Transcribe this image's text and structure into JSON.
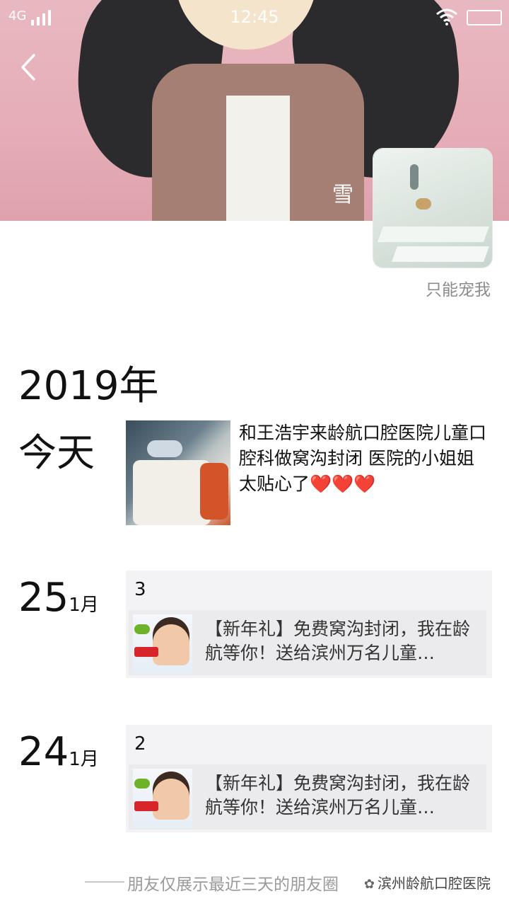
{
  "status_bar": {
    "network": "4G",
    "time": "12:45"
  },
  "profile": {
    "nickname": "雪",
    "signature": "只能宠我"
  },
  "timeline": {
    "year": "2019年",
    "today_label": "今天",
    "today_post_text": "和王浩宇来龄航口腔医院儿童口腔科做窝沟封闭 医院的小姐姐太贴心了❤️❤️❤️",
    "entries": [
      {
        "day": "25",
        "month": "1月",
        "count": "3",
        "link_title": "【新年礼】免费窝沟封闭，我在龄航等你！送给滨州万名儿童…"
      },
      {
        "day": "24",
        "month": "1月",
        "count": "2",
        "link_title": "【新年礼】免费窝沟封闭，我在龄航等你！送给滨州万名儿童…"
      }
    ]
  },
  "footer": {
    "notice": "朋友仅展示最近三天的朋友圈",
    "watermark": "滨州龄航口腔医院"
  },
  "icons": {
    "back": "back-chevron-icon",
    "wifi": "wifi-icon",
    "battery": "battery-icon",
    "signal": "signal-icon",
    "watermark": "wechat-icon"
  }
}
